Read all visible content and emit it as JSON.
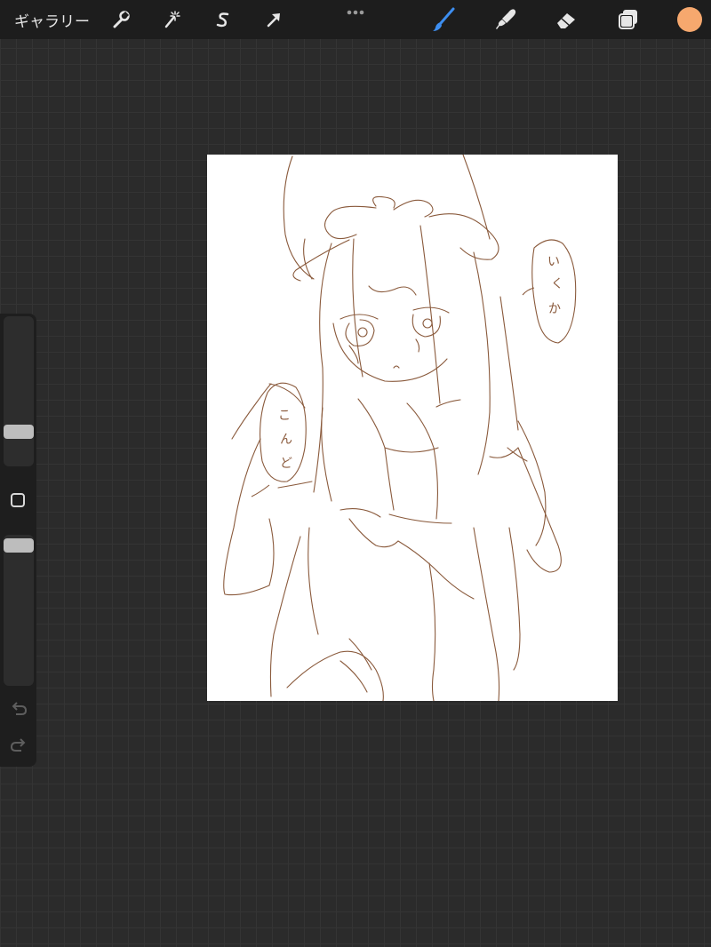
{
  "topbar": {
    "gallery_label": "ギャラリー",
    "left_tools": [
      "wrench-icon",
      "magic-wand-icon",
      "selection-s-icon",
      "transform-arrow-icon"
    ],
    "right_tools": [
      "brush-icon",
      "smudge-icon",
      "eraser-icon",
      "layers-icon"
    ],
    "active_tool": "brush",
    "active_tool_color": "#3d8ef0",
    "current_color": "#f6a86e"
  },
  "sidebar": {
    "brush_size_slider": "brush-size",
    "opacity_slider": "opacity",
    "undo": "undo-icon",
    "redo": "redo-icon"
  },
  "canvas": {
    "sketch_color": "#8a5a3c",
    "speech_right": [
      "い",
      "く",
      "か"
    ],
    "speech_left": [
      "こ",
      "ん",
      "ど"
    ]
  }
}
